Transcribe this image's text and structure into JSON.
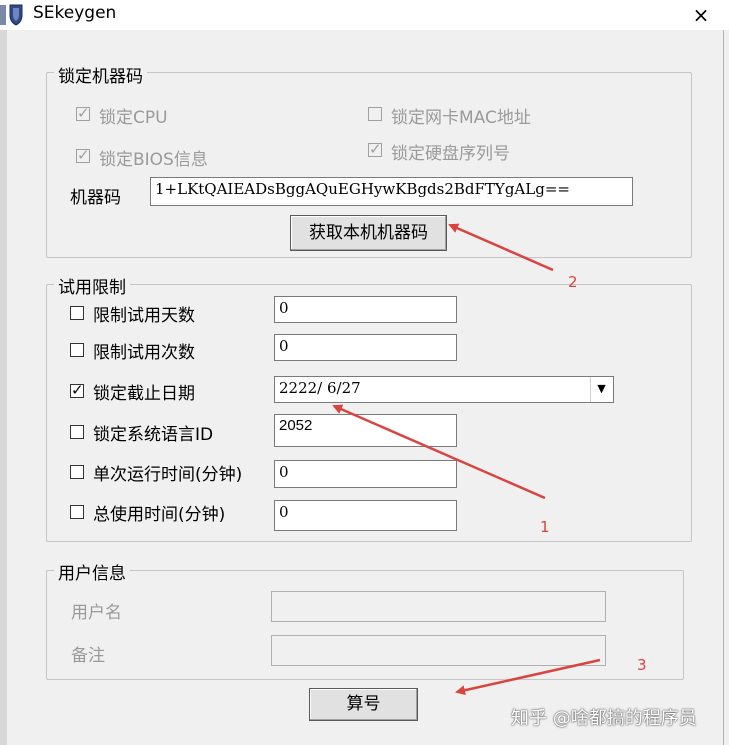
{
  "window": {
    "title": "SEkeygen",
    "close_icon": "×"
  },
  "lock_machine": {
    "legend": "锁定机器码",
    "options": [
      {
        "label": "锁定CPU",
        "checked": true,
        "disabled": true
      },
      {
        "label": "锁定网卡MAC地址",
        "checked": false,
        "disabled": true
      },
      {
        "label": "锁定BIOS信息",
        "checked": true,
        "disabled": true
      },
      {
        "label": "锁定硬盘序列号",
        "checked": true,
        "disabled": true
      }
    ],
    "machine_code_label": "机器码",
    "machine_code_value": "1+LKtQAIEADsBggAQuEGHywKBgds2BdFTYgALg==",
    "get_button_label": "获取本机机器码"
  },
  "trial": {
    "legend": "试用限制",
    "rows": [
      {
        "label": "限制试用天数",
        "checked": false,
        "value": "0"
      },
      {
        "label": "限制试用次数",
        "checked": false,
        "value": "0"
      },
      {
        "label": "锁定截止日期",
        "checked": true,
        "value": "2222/ 6/27"
      },
      {
        "label": "锁定系统语言ID",
        "checked": false,
        "value": "2052"
      },
      {
        "label": "单次运行时间(分钟)",
        "checked": false,
        "value": "0"
      },
      {
        "label": "总使用时间(分钟)",
        "checked": false,
        "value": "0"
      }
    ]
  },
  "user_info": {
    "legend": "用户信息",
    "username_label": "用户名",
    "username_value": "",
    "note_label": "备注",
    "note_value": ""
  },
  "calc_button_label": "算号",
  "annotations": {
    "arrow_1": "1",
    "arrow_2": "2",
    "arrow_3": "3",
    "color": "#d9443f"
  },
  "watermark": "知乎 @啥都搞的程序员",
  "icons": {
    "app": "shield-icon",
    "close": "close-icon",
    "combo": "chevron-down-icon"
  }
}
